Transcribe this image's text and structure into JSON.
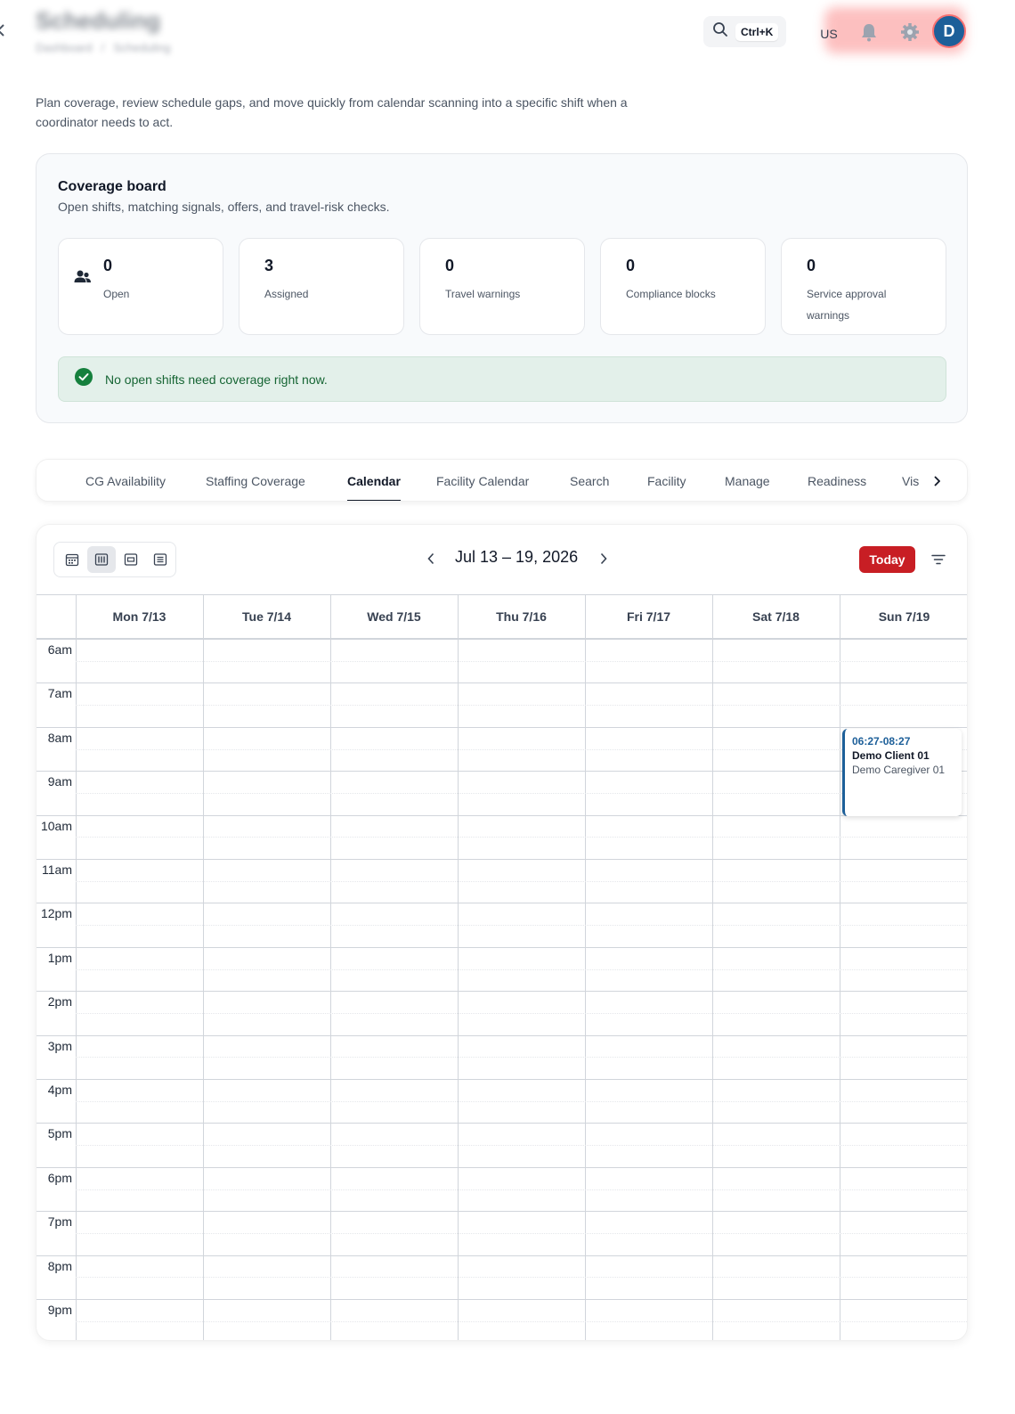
{
  "header": {
    "title": "Scheduling",
    "breadcrumb": [
      "Dashboard",
      "/",
      "Scheduling"
    ],
    "search_shortcut": "Ctrl+K",
    "locale": "US",
    "avatar_initial": "D"
  },
  "intro": "Plan coverage, review schedule gaps, and move quickly from calendar scanning into a specific shift when a coordinator needs to act.",
  "coverage_board": {
    "title": "Coverage board",
    "subtitle": "Open shifts, matching signals, offers, and travel-risk checks.",
    "stats": [
      {
        "value": "0",
        "label": "Open",
        "icon": "users-icon"
      },
      {
        "value": "3",
        "label": "Assigned"
      },
      {
        "value": "0",
        "label": "Travel warnings"
      },
      {
        "value": "0",
        "label": "Compliance blocks"
      },
      {
        "value": "0",
        "label": "Service approval warnings"
      }
    ],
    "notice": "No open shifts need coverage right now."
  },
  "tabs": [
    {
      "label": "CG Availability"
    },
    {
      "label": "Staffing Coverage"
    },
    {
      "label": "Calendar",
      "active": true
    },
    {
      "label": "Facility Calendar"
    },
    {
      "label": "Search"
    },
    {
      "label": "Facility"
    },
    {
      "label": "Manage"
    },
    {
      "label": "Readiness"
    },
    {
      "label": "Vis"
    }
  ],
  "calendar": {
    "range_label": "Jul 13 – 19, 2026",
    "today_label": "Today",
    "views": [
      "month-view-icon",
      "week-view-icon",
      "day-view-icon",
      "list-view-icon"
    ],
    "active_view": "week-view-icon",
    "days": [
      "Mon 7/13",
      "Tue 7/14",
      "Wed 7/15",
      "Thu 7/16",
      "Fri 7/17",
      "Sat 7/18",
      "Sun 7/19"
    ],
    "hours": [
      "6am",
      "7am",
      "8am",
      "9am",
      "10am",
      "11am",
      "12pm",
      "1pm",
      "2pm",
      "3pm",
      "4pm",
      "5pm",
      "6pm",
      "7pm",
      "8pm",
      "9pm"
    ],
    "event": {
      "time": "06:27-08:27",
      "client": "Demo Client 01",
      "caregiver": "Demo Caregiver 01",
      "day": "Sun 7/19"
    },
    "accent_color": "#1d5f99",
    "today_color": "#c81e24"
  }
}
